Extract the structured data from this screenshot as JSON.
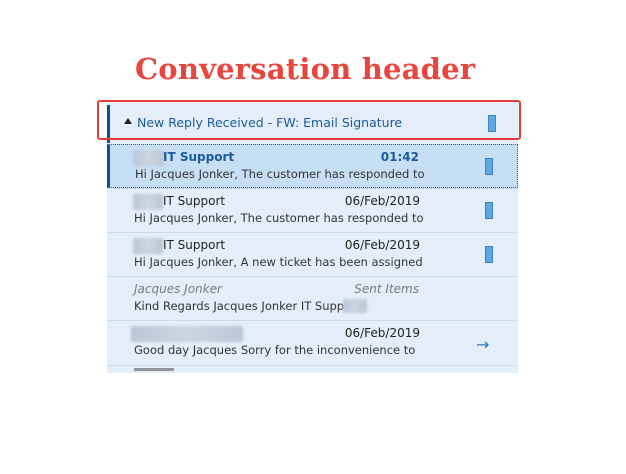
{
  "annotation": {
    "label": "Conversation header"
  },
  "conversation": {
    "title": "New Reply Received - FW: Email Signature"
  },
  "messages": [
    {
      "sender": "IT Support",
      "time": "01:42",
      "preview": "Hi Jacques Jonker,  The customer has responded to the",
      "selected": true,
      "flag": true
    },
    {
      "sender": "IT Support",
      "time": "06/Feb/2019",
      "preview": "Hi Jacques Jonker,  The customer has responded to the",
      "flag": true
    },
    {
      "sender": "IT Support",
      "time": "06/Feb/2019",
      "preview": "Hi Jacques Jonker,  A new ticket has been assigned to",
      "flag": true
    },
    {
      "sender": "Jacques Jonker",
      "time": "Sent Items",
      "preview": "Kind Regards  Jacques Jonker  IT Support",
      "flag": false
    },
    {
      "sender": "",
      "time": "06/Feb/2019",
      "preview": "Good day Jacques   Sorry for the inconvenience to",
      "flag": false,
      "icon": "forward-arrow-icon"
    }
  ],
  "colors": {
    "annotation": "#e8453c",
    "accent": "#1c5a9c",
    "flag": "#5ba8e2",
    "panel": "#e3eef8",
    "selected": "#c7dff4"
  }
}
